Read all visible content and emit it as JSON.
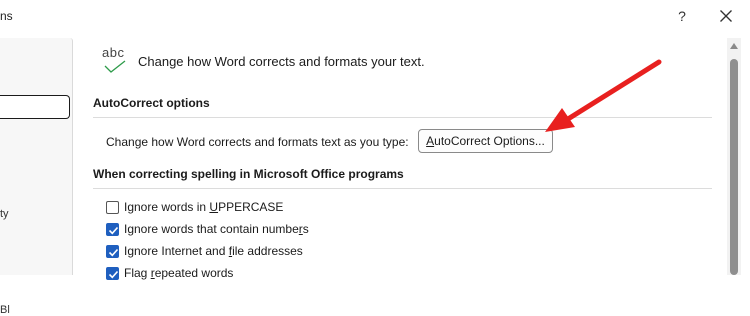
{
  "window": {
    "title_fragment": "ns",
    "help_label": "?",
    "close_label": "✕"
  },
  "sidebar": {
    "partial_item_1": "ty",
    "partial_item_2": "Bl"
  },
  "header": {
    "icon_text": "abc",
    "description": "Change how Word corrects and formats your text."
  },
  "autocorrect_section": {
    "heading": "AutoCorrect options",
    "row_label": "Change how Word corrects and formats text as you type:",
    "button_prefix": "",
    "button_underline": "A",
    "button_rest": "utoCorrect Options..."
  },
  "spelling_section": {
    "heading": "When correcting spelling in Microsoft Office programs",
    "options": [
      {
        "pre": "Ignore words in ",
        "key": "U",
        "post": "PPERCASE",
        "checked": false
      },
      {
        "pre": "Ignore words that contain numbe",
        "key": "r",
        "post": "s",
        "checked": true
      },
      {
        "pre": "Ignore Internet and ",
        "key": "f",
        "post": "ile addresses",
        "checked": true
      },
      {
        "pre": "Flag ",
        "key": "r",
        "post": "epeated words",
        "checked": true
      }
    ]
  },
  "colors": {
    "accent": "#1f5fbf",
    "annotation_arrow": "#e8201f"
  },
  "icons": {
    "close": "close-icon",
    "help": "help-icon",
    "abc_check": "spelling-check-icon",
    "scroll_up": "chevron-up-icon"
  }
}
